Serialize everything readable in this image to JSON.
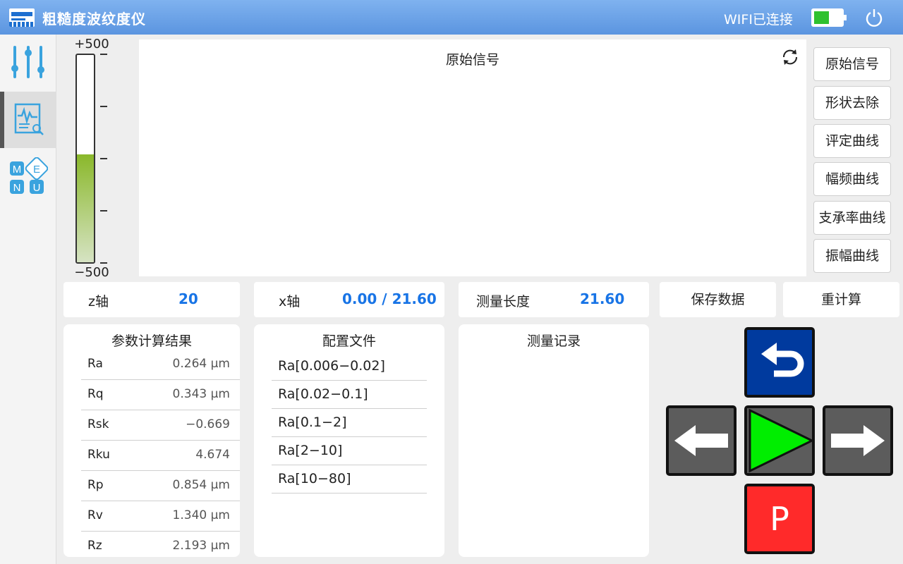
{
  "header": {
    "app_title": "粗糙度波纹度仪",
    "wifi_status": "WIFI已连接",
    "battery_level": 0.55,
    "battery_color": "#2fc12f",
    "icons": [
      "app-logo",
      "battery-icon",
      "power-icon"
    ]
  },
  "sidebar": {
    "items": [
      {
        "name": "settings",
        "icon": "sliders-icon",
        "active": false
      },
      {
        "name": "measure",
        "icon": "waveform-report-icon",
        "active": true
      },
      {
        "name": "menu",
        "icon": "menu-letters-icon",
        "active": false,
        "letters": [
          "M",
          "E",
          "N",
          "U"
        ]
      }
    ]
  },
  "gauge": {
    "max_label": "+500",
    "min_label": "−500",
    "min": -500,
    "max": 500,
    "value": 20
  },
  "chart": {
    "title": "原始信号",
    "refresh_icon": "refresh-icon"
  },
  "curve_buttons": [
    "原始信号",
    "形状去除",
    "评定曲线",
    "幅频曲线",
    "支承率曲线",
    "振幅曲线"
  ],
  "info": {
    "z_label": "z轴",
    "z_value": "20",
    "x_label": "x轴",
    "x_value": "0.00 / 21.60",
    "length_label": "测量长度",
    "length_value": "21.60",
    "save_label": "保存数据",
    "recalc_label": "重计算"
  },
  "results": {
    "title": "参数计算结果",
    "rows": [
      {
        "name": "Ra",
        "value": "0.264 μm"
      },
      {
        "name": "Rq",
        "value": "0.343 μm"
      },
      {
        "name": "Rsk",
        "value": "−0.669"
      },
      {
        "name": "Rku",
        "value": "4.674"
      },
      {
        "name": "Rp",
        "value": "0.854 μm"
      },
      {
        "name": "Rv",
        "value": "1.340 μm"
      },
      {
        "name": "Rz",
        "value": "2.193 μm"
      }
    ]
  },
  "config": {
    "title": "配置文件",
    "rows": [
      "Ra[0.006−0.02]",
      "Ra[0.02−0.1]",
      "Ra[0.1−2]",
      "Ra[2−10]",
      "Ra[10−80]"
    ]
  },
  "records": {
    "title": "测量记录"
  },
  "controls": {
    "park_label": "P",
    "colors": {
      "back": "#003a9e",
      "play": "#00ee00",
      "park": "#ff2a2a",
      "arrow": "#5c5c5c"
    },
    "icons": [
      "back-icon",
      "left-arrow-icon",
      "play-icon",
      "right-arrow-icon",
      "park-icon"
    ]
  }
}
